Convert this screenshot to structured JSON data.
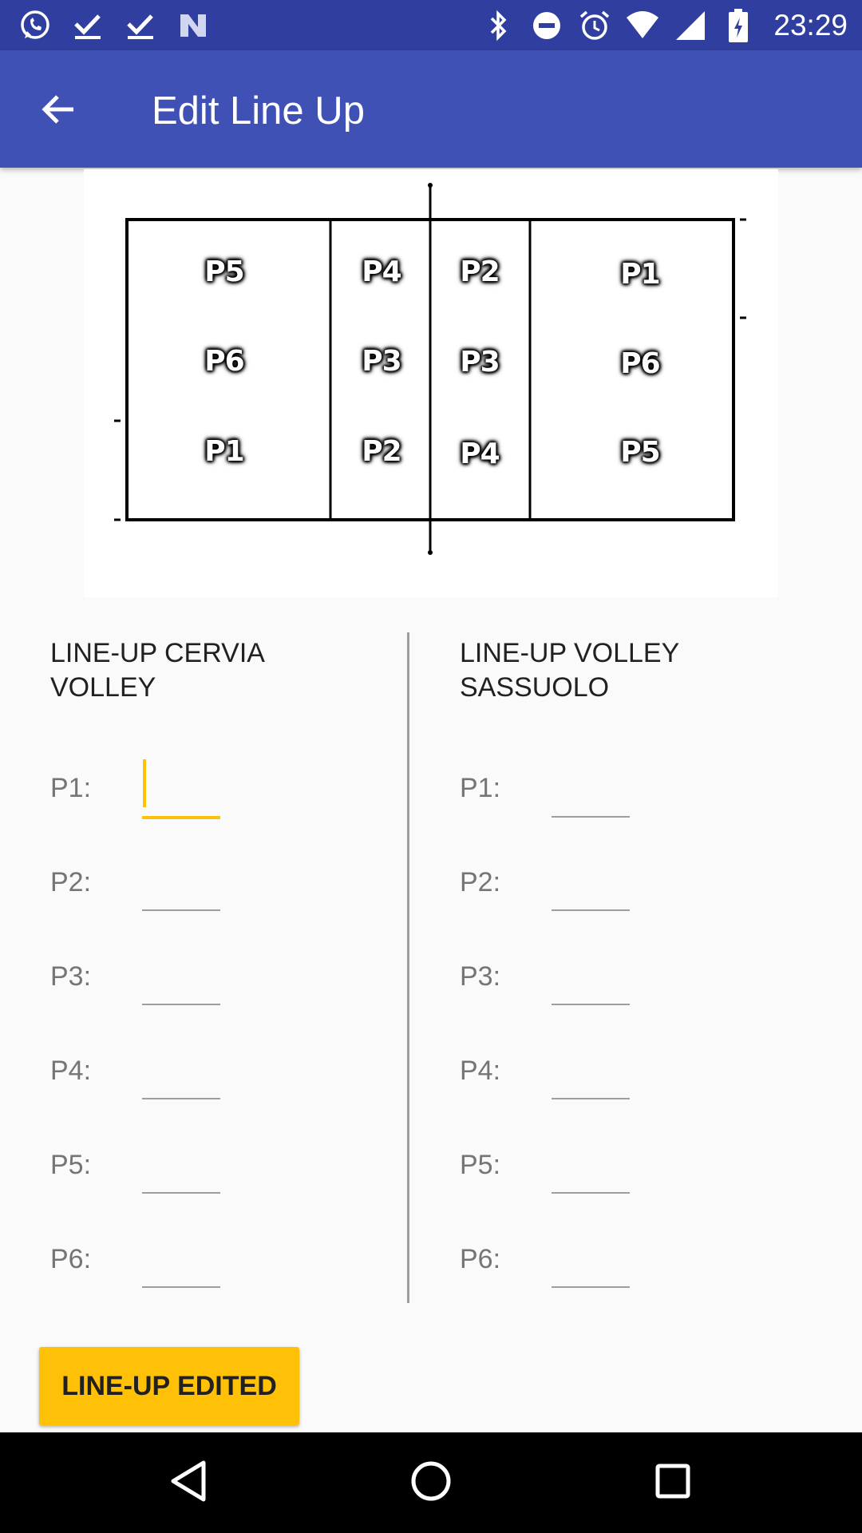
{
  "status_bar": {
    "time": "23:29",
    "left_icons": [
      "whatsapp-icon",
      "check-download-icon",
      "check-download-icon",
      "n-logo-icon"
    ],
    "right_icons": [
      "bluetooth-icon",
      "do-not-disturb-icon",
      "alarm-icon",
      "wifi-icon",
      "signal-icon",
      "battery-charging-icon"
    ]
  },
  "app_bar": {
    "title": "Edit Line Up",
    "back_icon": "arrow-back-icon",
    "color": "#3f51b5"
  },
  "court": {
    "left_side": [
      "P5",
      "P6",
      "P1",
      "P4",
      "P3",
      "P2"
    ],
    "right_side": [
      "P2",
      "P3",
      "P4",
      "P1",
      "P6",
      "P5"
    ]
  },
  "team_left": {
    "title": "LINE-UP CERVIA VOLLEY",
    "rows": [
      {
        "label": "P1:",
        "value": ""
      },
      {
        "label": "P2:",
        "value": ""
      },
      {
        "label": "P3:",
        "value": ""
      },
      {
        "label": "P4:",
        "value": ""
      },
      {
        "label": "P5:",
        "value": ""
      },
      {
        "label": "P6:",
        "value": ""
      }
    ]
  },
  "team_right": {
    "title": "LINE-UP VOLLEY SASSUOLO",
    "rows": [
      {
        "label": "P1:",
        "value": ""
      },
      {
        "label": "P2:",
        "value": ""
      },
      {
        "label": "P3:",
        "value": ""
      },
      {
        "label": "P4:",
        "value": ""
      },
      {
        "label": "P5:",
        "value": ""
      },
      {
        "label": "P6:",
        "value": ""
      }
    ]
  },
  "button": {
    "label": "LINE-UP EDITED",
    "color": "#ffc107"
  },
  "nav_bar": {
    "icons": [
      "back-triangle-icon",
      "home-circle-icon",
      "recents-square-icon"
    ]
  }
}
